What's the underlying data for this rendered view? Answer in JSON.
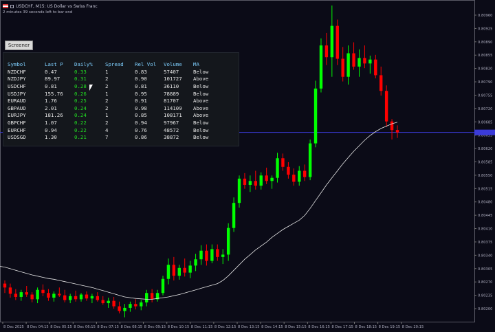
{
  "window": {
    "title": "USDCHF, M15:  US Dollar vs Swiss Franc",
    "status": "2 minutes 39 seconds left to bar end"
  },
  "toolbar": {
    "screener_label": "Screener"
  },
  "screener": {
    "headers": [
      "Symbol",
      "Last P",
      "Daily%",
      "Spread",
      "Rel Vol",
      "Volume",
      "MA"
    ],
    "rows": [
      [
        "NZDCHF",
        "0.47",
        "0.33",
        "1",
        "0.83",
        "57407",
        "Below"
      ],
      [
        "NZDJPY",
        "89.97",
        "0.31",
        "2",
        "0.90",
        "101727",
        "Above"
      ],
      [
        "USDCHF",
        "0.81",
        "0.28",
        "2",
        "0.81",
        "36110",
        "Below"
      ],
      [
        "USDJPY",
        "155.76",
        "0.26",
        "1",
        "0.95",
        "78889",
        "Below"
      ],
      [
        "EURAUD",
        "1.76",
        "0.25",
        "2",
        "0.91",
        "81707",
        "Above"
      ],
      [
        "GBPAUD",
        "2.01",
        "0.24",
        "2",
        "0.98",
        "114109",
        "Above"
      ],
      [
        "EURJPY",
        "181.26",
        "0.24",
        "1",
        "0.85",
        "108171",
        "Above"
      ],
      [
        "GBPCHF",
        "1.07",
        "0.22",
        "2",
        "0.94",
        "97967",
        "Below"
      ],
      [
        "EURCHF",
        "0.94",
        "0.22",
        "4",
        "0.76",
        "48572",
        "Below"
      ],
      [
        "USDSGD",
        "1.30",
        "0.21",
        "7",
        "0.86",
        "38872",
        "Below"
      ]
    ]
  },
  "colors": {
    "bull": "#00ff00",
    "bear": "#ff0000",
    "ma": "#e8e8e8",
    "bid_line": "#3b3bd8",
    "daily_pct": "#22dd22"
  },
  "chart_data": {
    "type": "candlestick",
    "symbol": "USDCHF",
    "timeframe": "M15",
    "current_price": 0.80658,
    "ylim": [
      0.8018,
      0.80982
    ],
    "price_ticks": [
      "0.80960",
      "0.80925",
      "0.80890",
      "0.80855",
      "0.80820",
      "0.80790",
      "0.80755",
      "0.80720",
      "0.80685",
      "0.80655",
      "0.80620",
      "0.80585",
      "0.80550",
      "0.80515",
      "0.80480",
      "0.80445",
      "0.80410",
      "0.80375",
      "0.80340",
      "0.80305",
      "0.80270",
      "0.80235",
      "0.80200"
    ],
    "time_ticks": [
      "8 Dec 2025",
      "8 Dec 04:15",
      "8 Dec 05:15",
      "8 Dec 06:15",
      "8 Dec 07:15",
      "8 Dec 08:15",
      "8 Dec 09:15",
      "8 Dec 10:15",
      "8 Dec 11:15",
      "8 Dec 12:15",
      "8 Dec 13:15",
      "8 Dec 14:15",
      "8 Dec 15:15",
      "8 Dec 16:15",
      "8 Dec 17:15",
      "8 Dec 18:15",
      "8 Dec 19:15",
      "8 Dec 20:15"
    ],
    "candles": [
      {
        "o": 0.80272,
        "h": 0.8028,
        "l": 0.80248,
        "c": 0.80262
      },
      {
        "o": 0.80262,
        "h": 0.80272,
        "l": 0.80236,
        "c": 0.80246
      },
      {
        "o": 0.80246,
        "h": 0.80258,
        "l": 0.8023,
        "c": 0.80238
      },
      {
        "o": 0.80238,
        "h": 0.80256,
        "l": 0.80228,
        "c": 0.8025
      },
      {
        "o": 0.8025,
        "h": 0.80266,
        "l": 0.80238,
        "c": 0.80244
      },
      {
        "o": 0.80244,
        "h": 0.8025,
        "l": 0.80224,
        "c": 0.80232
      },
      {
        "o": 0.80232,
        "h": 0.80262,
        "l": 0.80222,
        "c": 0.80256
      },
      {
        "o": 0.80256,
        "h": 0.8027,
        "l": 0.8024,
        "c": 0.80248
      },
      {
        "o": 0.80248,
        "h": 0.80258,
        "l": 0.80228,
        "c": 0.80236
      },
      {
        "o": 0.80236,
        "h": 0.80252,
        "l": 0.80226,
        "c": 0.80246
      },
      {
        "o": 0.80246,
        "h": 0.80262,
        "l": 0.80238,
        "c": 0.80242
      },
      {
        "o": 0.80242,
        "h": 0.80256,
        "l": 0.80224,
        "c": 0.8023
      },
      {
        "o": 0.8023,
        "h": 0.80246,
        "l": 0.80222,
        "c": 0.8024
      },
      {
        "o": 0.8024,
        "h": 0.80254,
        "l": 0.80226,
        "c": 0.80232
      },
      {
        "o": 0.80232,
        "h": 0.80248,
        "l": 0.80226,
        "c": 0.80244
      },
      {
        "o": 0.80244,
        "h": 0.80252,
        "l": 0.80228,
        "c": 0.80234
      },
      {
        "o": 0.80234,
        "h": 0.80246,
        "l": 0.80222,
        "c": 0.8024
      },
      {
        "o": 0.8024,
        "h": 0.8025,
        "l": 0.80226,
        "c": 0.8023
      },
      {
        "o": 0.8023,
        "h": 0.8024,
        "l": 0.80218,
        "c": 0.80222
      },
      {
        "o": 0.80222,
        "h": 0.80236,
        "l": 0.8021,
        "c": 0.80228
      },
      {
        "o": 0.80228,
        "h": 0.80238,
        "l": 0.80208,
        "c": 0.80214
      },
      {
        "o": 0.80214,
        "h": 0.80226,
        "l": 0.80196,
        "c": 0.80202
      },
      {
        "o": 0.80202,
        "h": 0.8022,
        "l": 0.80186,
        "c": 0.8021
      },
      {
        "o": 0.8021,
        "h": 0.80226,
        "l": 0.802,
        "c": 0.8022
      },
      {
        "o": 0.8022,
        "h": 0.80232,
        "l": 0.80206,
        "c": 0.80214
      },
      {
        "o": 0.80214,
        "h": 0.8023,
        "l": 0.80204,
        "c": 0.80224
      },
      {
        "o": 0.80224,
        "h": 0.80256,
        "l": 0.80214,
        "c": 0.80248
      },
      {
        "o": 0.80248,
        "h": 0.80258,
        "l": 0.80224,
        "c": 0.80232
      },
      {
        "o": 0.80232,
        "h": 0.80256,
        "l": 0.80226,
        "c": 0.80248
      },
      {
        "o": 0.80248,
        "h": 0.80292,
        "l": 0.80242,
        "c": 0.80284
      },
      {
        "o": 0.80284,
        "h": 0.80336,
        "l": 0.8027,
        "c": 0.8032
      },
      {
        "o": 0.8032,
        "h": 0.8034,
        "l": 0.8028,
        "c": 0.80292
      },
      {
        "o": 0.80292,
        "h": 0.8032,
        "l": 0.80282,
        "c": 0.80312
      },
      {
        "o": 0.80312,
        "h": 0.80336,
        "l": 0.8029,
        "c": 0.803
      },
      {
        "o": 0.803,
        "h": 0.8033,
        "l": 0.80286,
        "c": 0.80318
      },
      {
        "o": 0.80318,
        "h": 0.80348,
        "l": 0.80304,
        "c": 0.80334
      },
      {
        "o": 0.80334,
        "h": 0.8037,
        "l": 0.8032,
        "c": 0.80356
      },
      {
        "o": 0.80356,
        "h": 0.80372,
        "l": 0.80318,
        "c": 0.8033
      },
      {
        "o": 0.8033,
        "h": 0.80372,
        "l": 0.80324,
        "c": 0.8036
      },
      {
        "o": 0.8036,
        "h": 0.80372,
        "l": 0.8033,
        "c": 0.8034
      },
      {
        "o": 0.8034,
        "h": 0.8036,
        "l": 0.80322,
        "c": 0.80346
      },
      {
        "o": 0.80346,
        "h": 0.80426,
        "l": 0.8033,
        "c": 0.80414
      },
      {
        "o": 0.80414,
        "h": 0.80492,
        "l": 0.80404,
        "c": 0.80478
      },
      {
        "o": 0.80478,
        "h": 0.80548,
        "l": 0.80466,
        "c": 0.8054
      },
      {
        "o": 0.8054,
        "h": 0.80554,
        "l": 0.80514,
        "c": 0.80524
      },
      {
        "o": 0.80524,
        "h": 0.80548,
        "l": 0.80506,
        "c": 0.80534
      },
      {
        "o": 0.80534,
        "h": 0.8056,
        "l": 0.80512,
        "c": 0.80522
      },
      {
        "o": 0.80522,
        "h": 0.80556,
        "l": 0.80512,
        "c": 0.80548
      },
      {
        "o": 0.80548,
        "h": 0.80568,
        "l": 0.80526,
        "c": 0.80534
      },
      {
        "o": 0.80534,
        "h": 0.80548,
        "l": 0.80514,
        "c": 0.80542
      },
      {
        "o": 0.80542,
        "h": 0.80606,
        "l": 0.8053,
        "c": 0.80592
      },
      {
        "o": 0.80592,
        "h": 0.80604,
        "l": 0.8056,
        "c": 0.8057
      },
      {
        "o": 0.8057,
        "h": 0.80582,
        "l": 0.8054,
        "c": 0.8055
      },
      {
        "o": 0.8055,
        "h": 0.80566,
        "l": 0.80522,
        "c": 0.80532
      },
      {
        "o": 0.80532,
        "h": 0.80572,
        "l": 0.80522,
        "c": 0.8056
      },
      {
        "o": 0.8056,
        "h": 0.80576,
        "l": 0.80534,
        "c": 0.80544
      },
      {
        "o": 0.80544,
        "h": 0.8064,
        "l": 0.80536,
        "c": 0.8063
      },
      {
        "o": 0.8063,
        "h": 0.8079,
        "l": 0.8062,
        "c": 0.8077
      },
      {
        "o": 0.8077,
        "h": 0.80898,
        "l": 0.8076,
        "c": 0.8088
      },
      {
        "o": 0.8088,
        "h": 0.80912,
        "l": 0.8083,
        "c": 0.8085
      },
      {
        "o": 0.8085,
        "h": 0.80982,
        "l": 0.808,
        "c": 0.8093
      },
      {
        "o": 0.8093,
        "h": 0.80946,
        "l": 0.8083,
        "c": 0.80846
      },
      {
        "o": 0.80846,
        "h": 0.80876,
        "l": 0.80788,
        "c": 0.808
      },
      {
        "o": 0.808,
        "h": 0.8088,
        "l": 0.8078,
        "c": 0.8086
      },
      {
        "o": 0.8086,
        "h": 0.80888,
        "l": 0.80818,
        "c": 0.80826
      },
      {
        "o": 0.80826,
        "h": 0.8087,
        "l": 0.808,
        "c": 0.80848
      },
      {
        "o": 0.80848,
        "h": 0.8088,
        "l": 0.80822,
        "c": 0.80834
      },
      {
        "o": 0.80834,
        "h": 0.80854,
        "l": 0.80808,
        "c": 0.80844
      },
      {
        "o": 0.80844,
        "h": 0.80856,
        "l": 0.80796,
        "c": 0.80804
      },
      {
        "o": 0.80804,
        "h": 0.80826,
        "l": 0.80752,
        "c": 0.80764
      },
      {
        "o": 0.80764,
        "h": 0.80778,
        "l": 0.80672,
        "c": 0.80686
      },
      {
        "o": 0.80686,
        "h": 0.80692,
        "l": 0.8064,
        "c": 0.80664
      },
      {
        "o": 0.80664,
        "h": 0.80676,
        "l": 0.80644,
        "c": 0.80658
      }
    ],
    "ma": [
      0.80316,
      0.80314,
      0.8031,
      0.80306,
      0.80302,
      0.80298,
      0.80294,
      0.80291,
      0.80288,
      0.80285,
      0.80283,
      0.8028,
      0.80277,
      0.80274,
      0.80271,
      0.80268,
      0.80265,
      0.80262,
      0.80258,
      0.80254,
      0.8025,
      0.80246,
      0.80242,
      0.80238,
      0.80236,
      0.80234,
      0.80233,
      0.80232,
      0.80232,
      0.80234,
      0.80236,
      0.80238,
      0.80241,
      0.80244,
      0.80248,
      0.80252,
      0.80256,
      0.8026,
      0.80264,
      0.80268,
      0.80272,
      0.8028,
      0.80292,
      0.80306,
      0.8032,
      0.80334,
      0.80346,
      0.80358,
      0.80368,
      0.80378,
      0.8039,
      0.804,
      0.8041,
      0.80418,
      0.80426,
      0.80434,
      0.80446,
      0.80464,
      0.80484,
      0.80504,
      0.80524,
      0.80542,
      0.8056,
      0.80578,
      0.80594,
      0.8061,
      0.80624,
      0.80638,
      0.8065,
      0.8066,
      0.80668,
      0.80674,
      0.8068,
      0.80684
    ]
  }
}
